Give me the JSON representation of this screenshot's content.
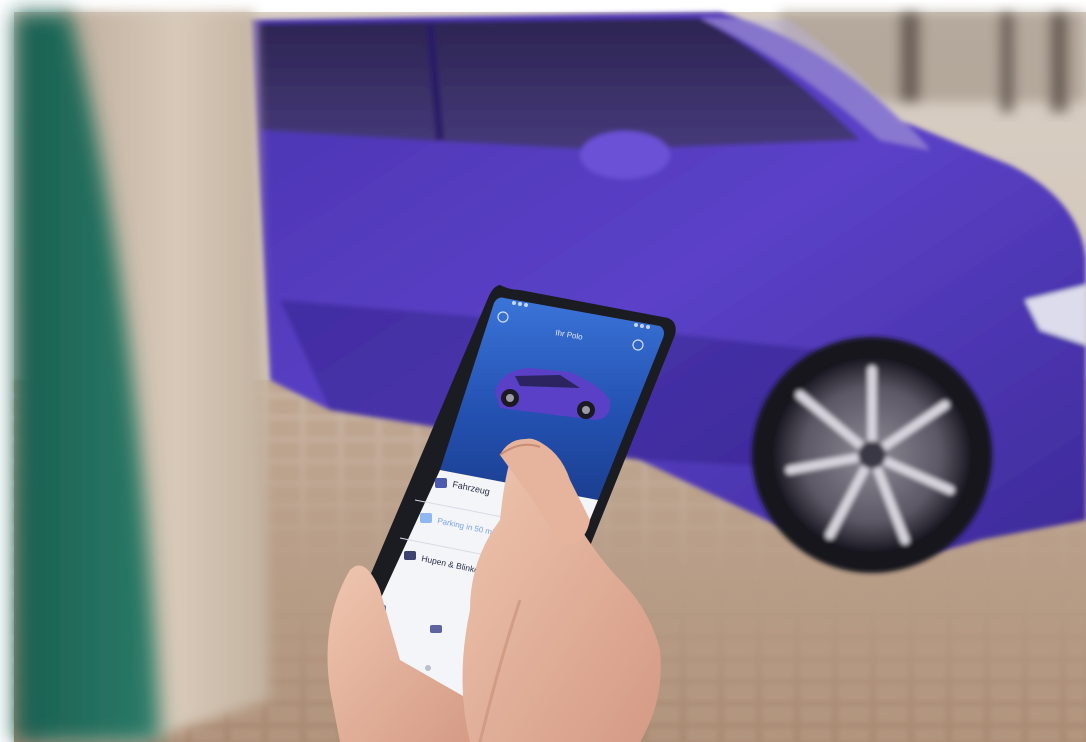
{
  "photo": {
    "subject": "photo-scene",
    "colors": {
      "car": "#5a3fc4",
      "car_dark": "#2a1a7a",
      "pavement": "#b89c84",
      "pillar": "#c9b8a6",
      "green_blur": "#1f6e5c",
      "phone_screen_top": "#2b63c9",
      "skin": "#e2b09a"
    }
  },
  "phone_app": {
    "header_title": "Ihr Polo",
    "menu_items": [
      {
        "label": "Fahrzeug",
        "icon": "lock-icon"
      },
      {
        "label": "Parking in 50 min",
        "icon": "parking-icon"
      },
      {
        "label": "Hupen & Blinken",
        "icon": "horn-icon"
      }
    ]
  }
}
